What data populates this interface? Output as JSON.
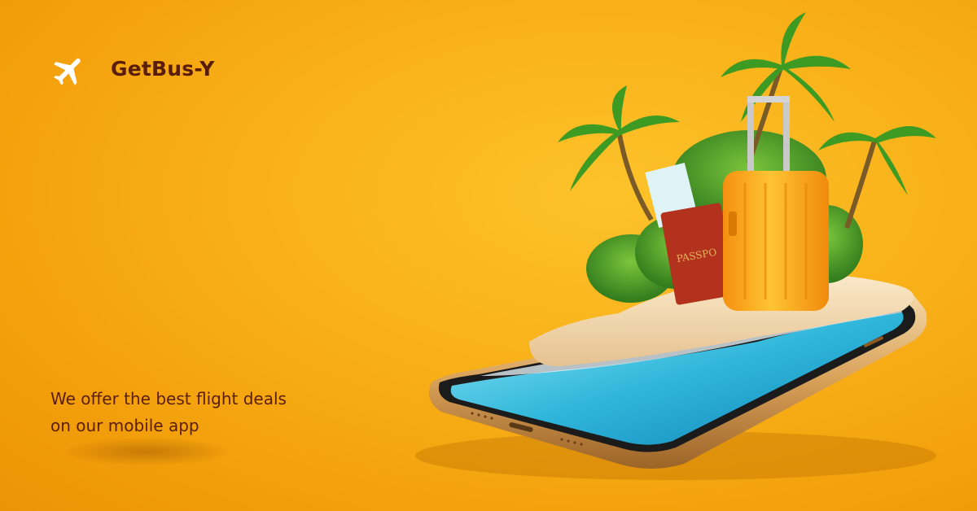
{
  "brand": {
    "name": "GetBus-Y",
    "icon": "airplane-icon"
  },
  "tagline": {
    "line1": "We offer the best flight deals",
    "line2": "on our mobile app"
  },
  "illustration": {
    "passport_text": "PASSPO",
    "icons": [
      "smartphone",
      "beach-water",
      "sand",
      "palm-tree",
      "suitcase",
      "passport",
      "boarding-pass"
    ]
  },
  "colors": {
    "background": "#f9b21a",
    "text": "#5a1e08",
    "icon": "#ffffff",
    "suitcase": "#ffa31a",
    "passport": "#b2321d"
  }
}
